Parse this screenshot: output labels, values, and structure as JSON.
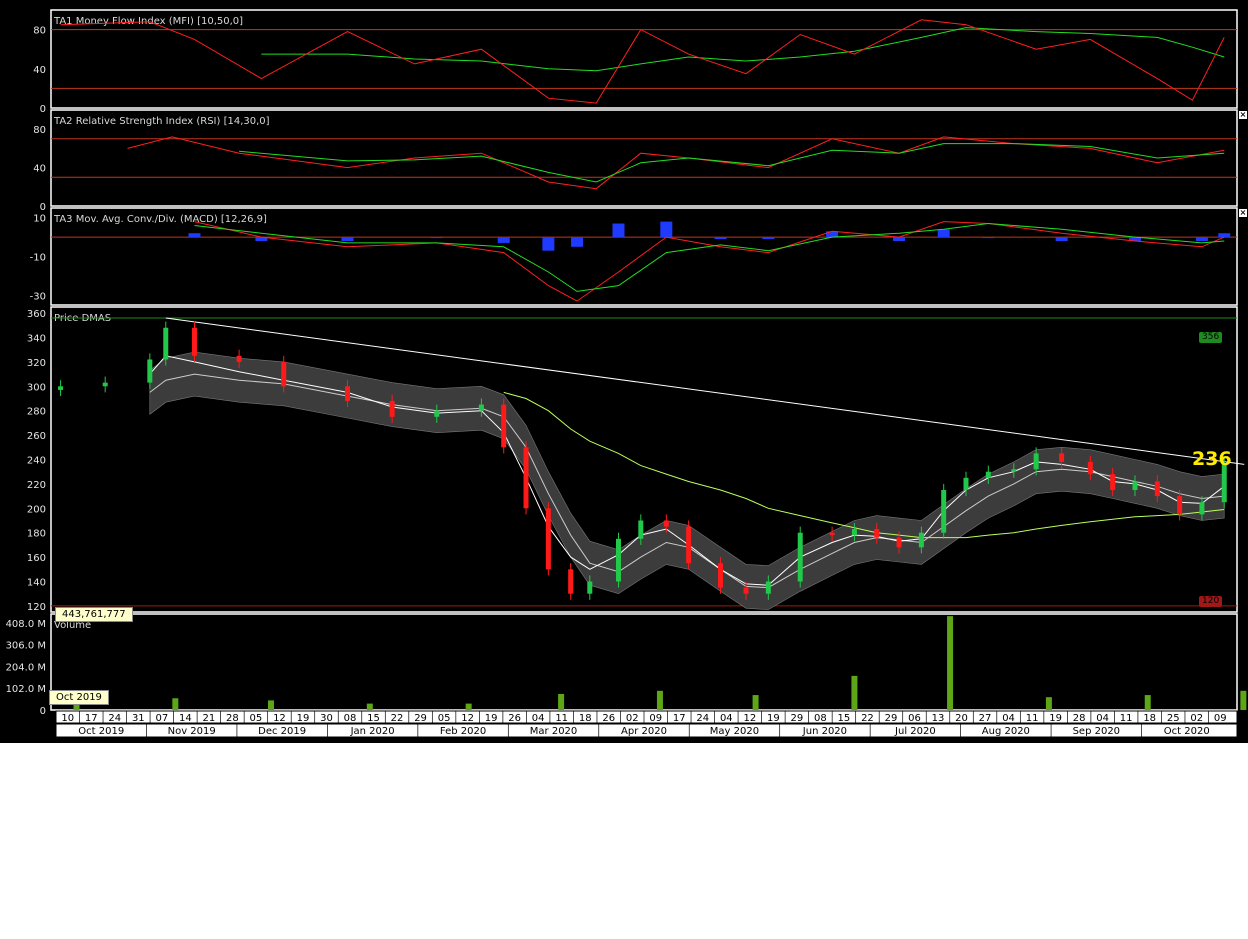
{
  "colors": {
    "background": "#000000",
    "frame": "#ffffff",
    "up_candle": "#22c84a",
    "down_candle": "#ff1a1a",
    "fast_line": "#ff2020",
    "slow_line": "#22dd22",
    "macd_hist": "#1f3bff",
    "band_fill": "#3c3c3c",
    "volume": "#5ca618",
    "level_line": "#c0381a"
  },
  "panels": {
    "mfi": {
      "title": "TA1 Money Flow Index (MFI) [10,50,0]",
      "ticks": [
        "80",
        "40",
        "0"
      ]
    },
    "rsi": {
      "title": "TA2 Relative Strength Index (RSI) [14,30,0]",
      "ticks": [
        "80",
        "40",
        "0"
      ]
    },
    "macd": {
      "title": "TA3 Mov. Avg. Conv./Div. (MACD) [12,26,9]",
      "ticks": [
        "10",
        "-10",
        "-30"
      ]
    },
    "price": {
      "title": "Price DMAS",
      "ticks": [
        "360",
        "340",
        "320",
        "300",
        "280",
        "260",
        "240",
        "220",
        "200",
        "180",
        "160",
        "140",
        "120"
      ]
    },
    "volume": {
      "title": "Volume",
      "ticks": [
        "408.0 M",
        "306.0 M",
        "204.0 M",
        "102.0 M",
        "0"
      ]
    }
  },
  "labels": {
    "last_price": "236",
    "high_tag": "356",
    "low_tag": "120",
    "cursor_value": "443,761,777",
    "cursor_date": "Oct 2019",
    "close_glyph": "×"
  },
  "axis": {
    "weeks": [
      "10",
      "17",
      "24",
      "31",
      "07",
      "14",
      "21",
      "28",
      "05",
      "12",
      "19",
      "30",
      "08",
      "15",
      "22",
      "29",
      "05",
      "12",
      "19",
      "26",
      "04",
      "11",
      "18",
      "26",
      "02",
      "09",
      "17",
      "24",
      "04",
      "12",
      "19",
      "29",
      "08",
      "15",
      "22",
      "29",
      "06",
      "13",
      "20",
      "27",
      "04",
      "11",
      "19",
      "28",
      "04",
      "11",
      "18",
      "25",
      "02",
      "09"
    ],
    "months": [
      "Oct 2019",
      "Nov 2019",
      "Dec 2019",
      "Jan 2020",
      "Feb 2020",
      "Mar 2020",
      "Apr 2020",
      "May 2020",
      "Jun 2020",
      "Jul 2020",
      "Aug 2020",
      "Sep 2020",
      "Oct 2020"
    ]
  },
  "chart_data": [
    {
      "type": "line",
      "name": "MFI",
      "title": "TA1 Money Flow Index (MFI) [10,50,0]",
      "ylim": [
        0,
        100
      ],
      "levels": [
        20,
        80
      ],
      "x": [
        "2019-10-10",
        "2019-11-07",
        "2019-11-21",
        "2019-12-12",
        "2020-01-08",
        "2020-01-29",
        "2020-02-19",
        "2020-03-11",
        "2020-03-26",
        "2020-04-09",
        "2020-04-24",
        "2020-05-12",
        "2020-05-29",
        "2020-06-15",
        "2020-07-06",
        "2020-07-20",
        "2020-08-11",
        "2020-08-28",
        "2020-09-18",
        "2020-09-29",
        "2020-10-09"
      ],
      "series": [
        {
          "name": "MFI",
          "values": [
            85,
            88,
            70,
            30,
            78,
            45,
            60,
            10,
            5,
            80,
            55,
            35,
            75,
            55,
            90,
            85,
            60,
            70,
            30,
            8,
            72
          ]
        },
        {
          "name": "MFI signal",
          "values": [
            null,
            null,
            null,
            55,
            55,
            50,
            48,
            40,
            38,
            45,
            52,
            48,
            52,
            58,
            72,
            82,
            78,
            76,
            72,
            62,
            52
          ]
        }
      ]
    },
    {
      "type": "line",
      "name": "RSI",
      "title": "TA2 Relative Strength Index (RSI) [14,30,0]",
      "ylim": [
        0,
        100
      ],
      "levels": [
        30,
        70
      ],
      "x": [
        "2019-10-31",
        "2019-11-14",
        "2019-12-05",
        "2020-01-08",
        "2020-01-29",
        "2020-02-19",
        "2020-03-11",
        "2020-03-26",
        "2020-04-09",
        "2020-04-24",
        "2020-05-19",
        "2020-06-08",
        "2020-06-29",
        "2020-07-13",
        "2020-08-04",
        "2020-08-28",
        "2020-09-18",
        "2020-10-09"
      ],
      "series": [
        {
          "name": "RSI",
          "values": [
            60,
            72,
            55,
            40,
            50,
            55,
            25,
            18,
            55,
            50,
            40,
            70,
            55,
            72,
            65,
            60,
            45,
            58
          ]
        },
        {
          "name": "RSI signal",
          "values": [
            null,
            null,
            57,
            47,
            48,
            52,
            35,
            25,
            45,
            50,
            42,
            58,
            55,
            65,
            65,
            62,
            50,
            55
          ]
        }
      ]
    },
    {
      "type": "line",
      "name": "MACD",
      "title": "TA3 Mov. Avg. Conv./Div. (MACD) [12,26,9]",
      "ylim": [
        -35,
        15
      ],
      "x": [
        "2019-11-21",
        "2019-12-12",
        "2020-01-08",
        "2020-02-05",
        "2020-02-26",
        "2020-03-11",
        "2020-03-20",
        "2020-04-02",
        "2020-04-17",
        "2020-05-04",
        "2020-05-19",
        "2020-06-08",
        "2020-06-29",
        "2020-07-13",
        "2020-07-27",
        "2020-08-19",
        "2020-09-11",
        "2020-10-02",
        "2020-10-09"
      ],
      "series": [
        {
          "name": "MACD",
          "values": [
            8,
            0,
            -5,
            -3,
            -8,
            -25,
            -33,
            -18,
            0,
            -5,
            -8,
            3,
            0,
            8,
            7,
            2,
            -2,
            -5,
            0
          ]
        },
        {
          "name": "Signal",
          "values": [
            6,
            2,
            -3,
            -3,
            -5,
            -18,
            -28,
            -25,
            -8,
            -4,
            -7,
            0,
            2,
            4,
            7,
            4,
            0,
            -3,
            -2
          ]
        },
        {
          "name": "Histogram",
          "values": [
            2,
            -2,
            -2,
            0,
            -3,
            -7,
            -5,
            7,
            8,
            -1,
            -1,
            3,
            -2,
            4,
            0,
            -2,
            -2,
            -2,
            2
          ]
        }
      ]
    },
    {
      "type": "line",
      "name": "Price DMAS",
      "title": "Price DMAS",
      "ylim": [
        115,
        365
      ],
      "last_price": 236,
      "levels": [
        356,
        120
      ],
      "x": [
        "2019-10-10",
        "2019-10-24",
        "2019-11-07",
        "2019-11-12",
        "2019-11-21",
        "2019-12-05",
        "2019-12-19",
        "2020-01-08",
        "2020-01-22",
        "2020-02-05",
        "2020-02-19",
        "2020-02-26",
        "2020-03-04",
        "2020-03-11",
        "2020-03-18",
        "2020-03-24",
        "2020-04-02",
        "2020-04-09",
        "2020-04-17",
        "2020-04-24",
        "2020-05-04",
        "2020-05-12",
        "2020-05-19",
        "2020-05-29",
        "2020-06-08",
        "2020-06-15",
        "2020-06-22",
        "2020-06-29",
        "2020-07-06",
        "2020-07-13",
        "2020-07-20",
        "2020-07-27",
        "2020-08-04",
        "2020-08-11",
        "2020-08-19",
        "2020-08-28",
        "2020-09-04",
        "2020-09-11",
        "2020-09-18",
        "2020-09-25",
        "2020-10-02",
        "2020-10-09"
      ],
      "series": [
        {
          "name": "Close",
          "values": [
            300,
            303,
            322,
            348,
            325,
            320,
            300,
            288,
            275,
            280,
            285,
            250,
            200,
            150,
            130,
            140,
            175,
            190,
            185,
            155,
            135,
            130,
            140,
            180,
            178,
            183,
            176,
            168,
            180,
            215,
            225,
            230,
            232,
            245,
            238,
            228,
            215,
            222,
            210,
            195,
            205,
            236
          ]
        },
        {
          "name": "MA short",
          "values": [
            null,
            null,
            310,
            325,
            320,
            312,
            305,
            295,
            283,
            278,
            280,
            262,
            225,
            185,
            160,
            150,
            162,
            178,
            183,
            170,
            150,
            138,
            137,
            160,
            172,
            178,
            177,
            173,
            175,
            198,
            215,
            225,
            230,
            238,
            236,
            232,
            222,
            220,
            215,
            205,
            204,
            218
          ]
        },
        {
          "name": "MA long",
          "values": [
            null,
            null,
            295,
            305,
            310,
            305,
            302,
            292,
            285,
            280,
            282,
            275,
            250,
            212,
            178,
            155,
            148,
            160,
            172,
            168,
            150,
            136,
            135,
            150,
            163,
            172,
            176,
            174,
            172,
            185,
            198,
            210,
            220,
            230,
            232,
            230,
            226,
            222,
            218,
            212,
            208,
            210
          ]
        },
        {
          "name": "MA 200",
          "values": [
            null,
            null,
            null,
            null,
            null,
            null,
            null,
            null,
            null,
            null,
            null,
            295,
            290,
            280,
            265,
            255,
            245,
            235,
            228,
            222,
            215,
            208,
            200,
            194,
            188,
            184,
            180,
            178,
            176,
            176,
            176,
            178,
            180,
            183,
            186,
            189,
            191,
            193,
            194,
            195,
            197,
            199
          ]
        }
      ],
      "trendline": {
        "from": [
          "2019-11-12",
          356
        ],
        "to": [
          "2020-10-09",
          236
        ]
      }
    },
    {
      "type": "bar",
      "name": "Volume",
      "title": "Volume",
      "ylim": [
        0,
        450
      ],
      "unit": "M",
      "cursor_value": 443761777,
      "x": [
        "2019-10",
        "2019-11",
        "2019-12",
        "2020-01",
        "2020-02",
        "2020-03",
        "2020-04",
        "2020-05",
        "2020-06",
        "2020-07",
        "2020-08",
        "2020-09",
        "2020-10"
      ],
      "values": [
        40,
        55,
        45,
        30,
        30,
        75,
        90,
        70,
        160,
        440,
        60,
        70,
        90
      ]
    }
  ]
}
